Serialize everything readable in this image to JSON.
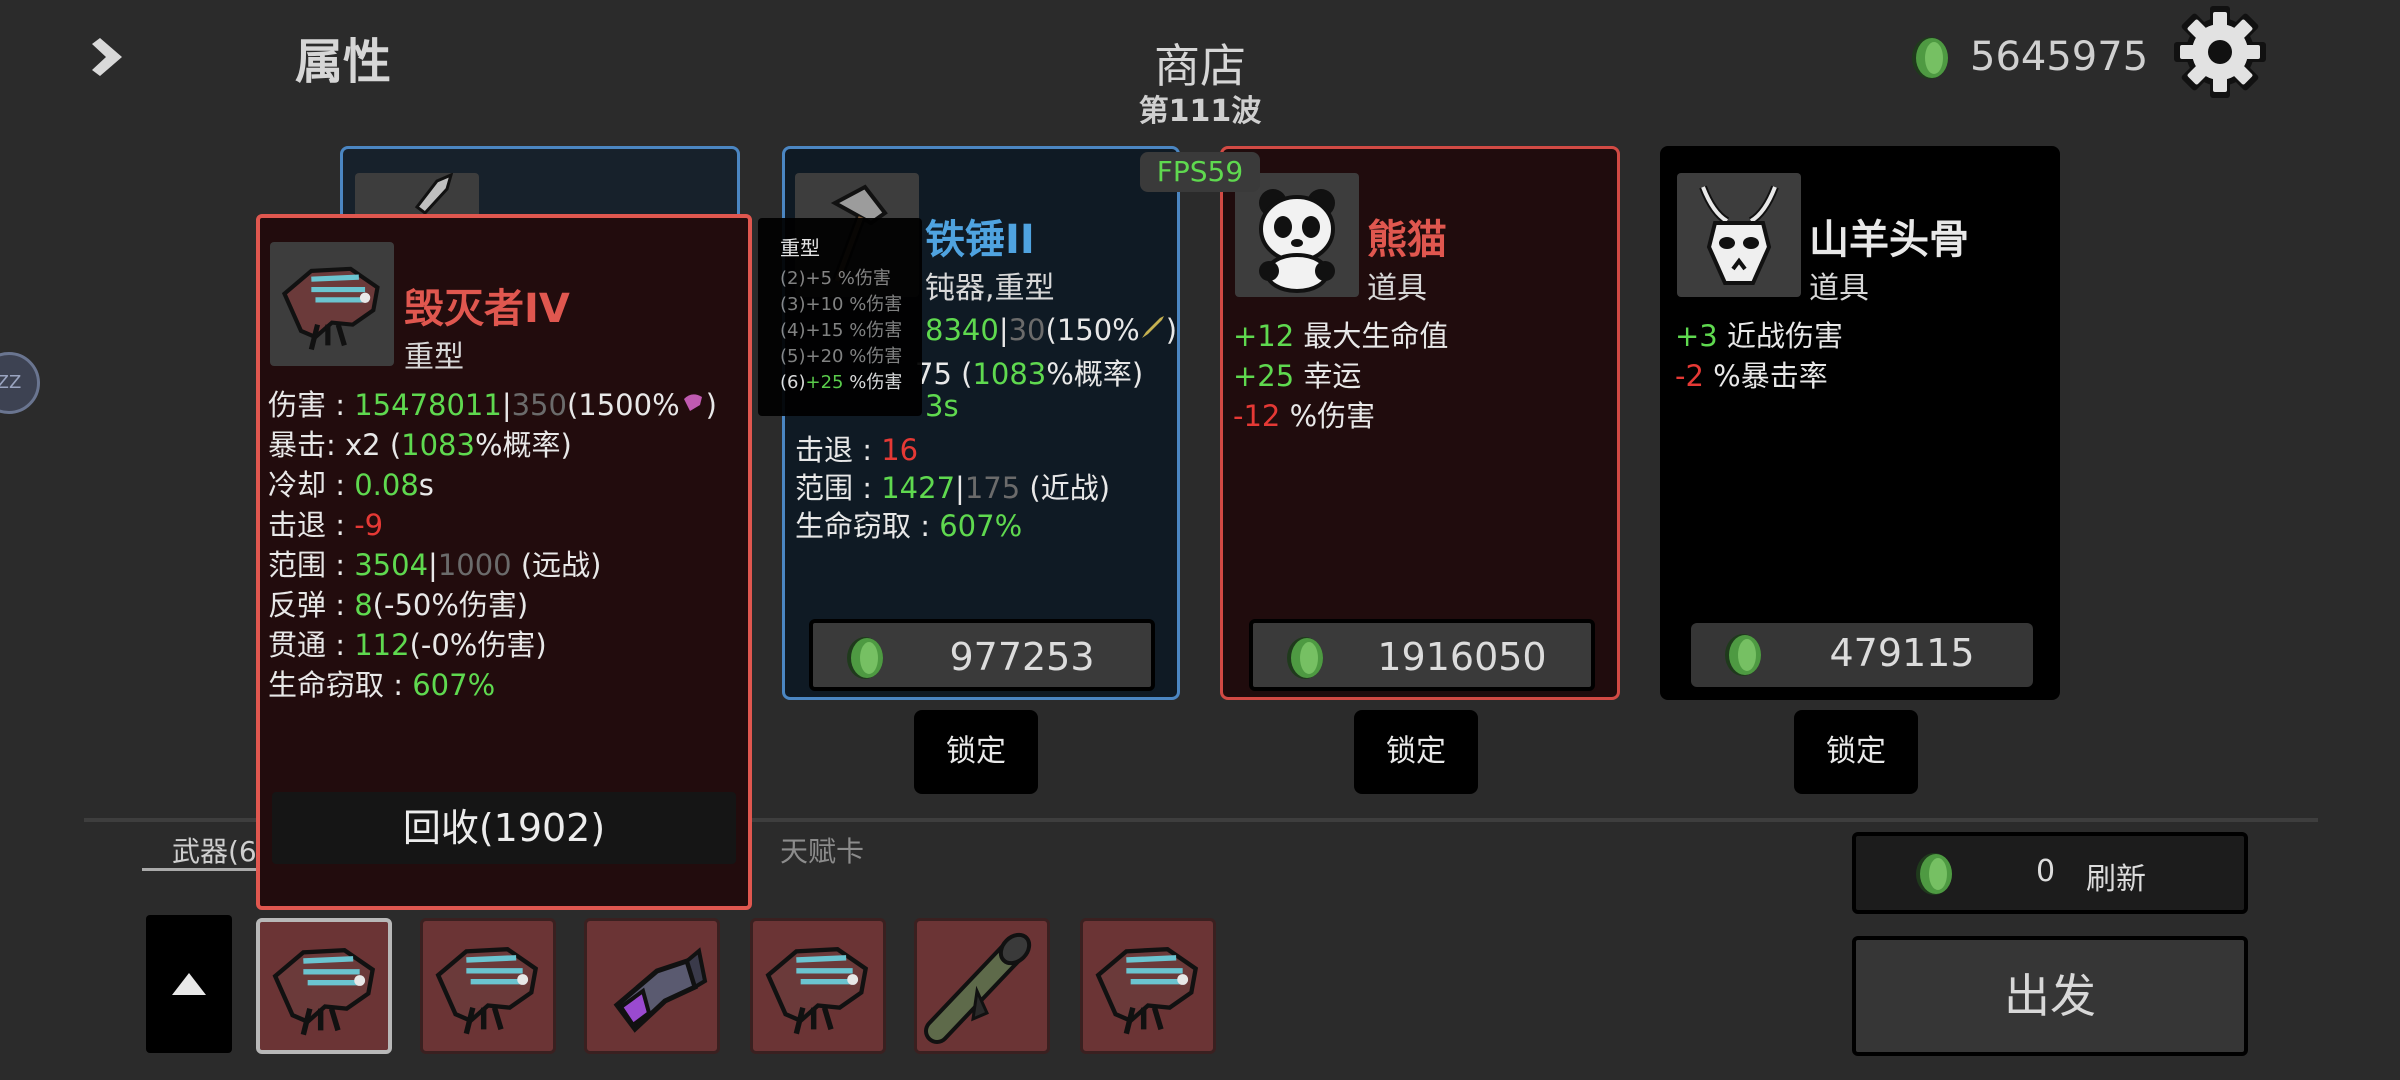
{
  "header": {
    "title": "属性",
    "shop_title": "商店",
    "wave": "第111波",
    "fps": "FPS59",
    "coins": "5645975"
  },
  "colors": {
    "positive": "#5fd94f",
    "negative": "#e53935",
    "rare_blue": "#4fa3e0",
    "legendary_red": "#e0574f"
  },
  "icons": [
    "chevron-right-icon",
    "gear-icon",
    "coin-icon",
    "sword-icon",
    "hammer-icon",
    "panda-icon",
    "goat-skull-icon",
    "dragon-gun-icon",
    "gauntlet-icon",
    "bazooka-icon",
    "triangle-up-icon"
  ],
  "popup": {
    "name": "毁灭者IV",
    "type": "重型",
    "damage_label": "伤害 : ",
    "damage_value": "15478011",
    "damage_sep": "|",
    "damage_base": "350",
    "damage_scale": "(1500%",
    "damage_end": ")",
    "crit_label": "暴击:",
    "crit_mult": " x2 (",
    "crit_chance": "1083",
    "crit_end": "%概率)",
    "cooldown_label": "冷却 : ",
    "cooldown_value": "0.08",
    "cooldown_unit": "s",
    "knockback_label": "击退 : ",
    "knockback_value": "-9",
    "range_label": "范围 : ",
    "range_value": "3504",
    "range_sep": "|",
    "range_base": "1000",
    "range_type": " (远战)",
    "bounce_label": "反弹 : ",
    "bounce_value": "8",
    "bounce_note": "(-50%伤害)",
    "pierce_label": "贯通 : ",
    "pierce_value": "112",
    "pierce_note": "(-0%伤害)",
    "lifesteal_label": "生命窃取 : ",
    "lifesteal_value": "607%",
    "recycle": "回收(1902)"
  },
  "tooltip": {
    "title": "重型",
    "lines": [
      "(2)+5 %伤害",
      "(3)+10 %伤害",
      "(4)+15 %伤害",
      "(5)+20 %伤害"
    ],
    "active_prefix": "(6)",
    "active_value": "+25",
    "active_suffix": " %伤害"
  },
  "shop": {
    "hammer": {
      "name": "铁锤II",
      "type": "钝器,重型",
      "damage_value": "8340",
      "damage_sep": "|",
      "damage_base": "30",
      "damage_scale": "(150%",
      "damage_end": ")",
      "crit_value": "75",
      "crit_open": " (",
      "crit_chance": "1083",
      "crit_end": "%概率)",
      "cooldown_value": "3s",
      "knockback_label": "击退 : ",
      "knockback_value": "16",
      "range_label": "范围 : ",
      "range_value": "1427",
      "range_sep": "|",
      "range_base": "175",
      "range_type": " (近战)",
      "lifesteal_label": "生命窃取 : ",
      "lifesteal_value": "607%",
      "price": "977253",
      "lock": "锁定"
    },
    "panda": {
      "name": "熊猫",
      "type": "道具",
      "stats": [
        {
          "value": "+12",
          "label": " 最大生命值"
        },
        {
          "value": "+25",
          "label": " 幸运"
        },
        {
          "value": "-12",
          "label": " %伤害"
        }
      ],
      "price": "1916050",
      "lock": "锁定"
    },
    "goat": {
      "name": "山羊头骨",
      "type": "道具",
      "stats": [
        {
          "value": "+3",
          "label": " 近战伤害"
        },
        {
          "value": "-2",
          "label": " %暴击率"
        }
      ],
      "price": "479115",
      "lock": "锁定"
    }
  },
  "tabs": {
    "weapons": "武器(6",
    "talent": "天赋卡"
  },
  "refresh": {
    "count": "0",
    "label": "刷新"
  },
  "depart": "出发",
  "badge": "ZZ"
}
